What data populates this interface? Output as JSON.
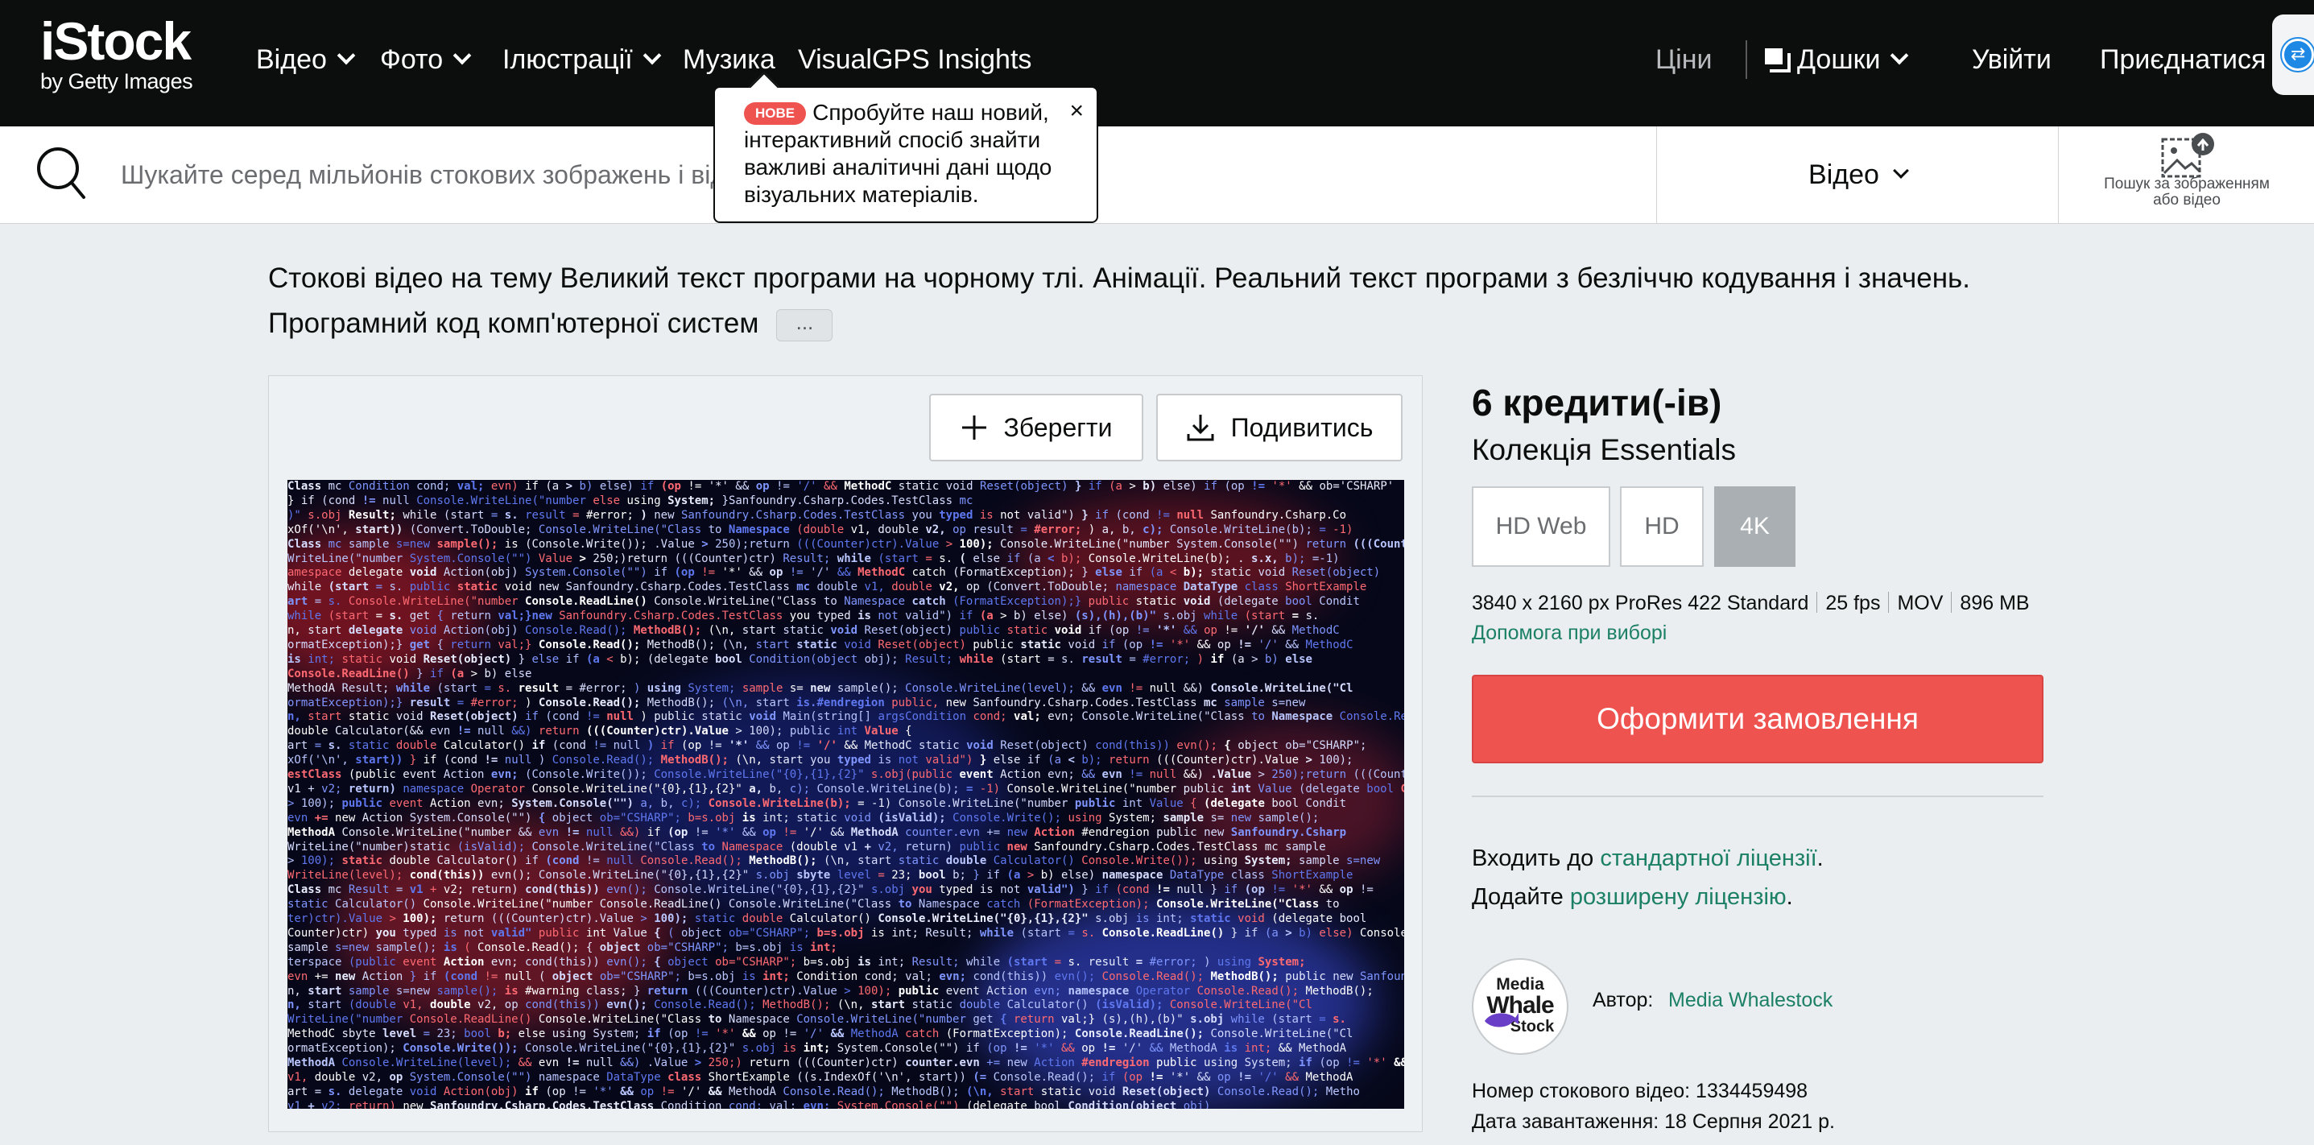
{
  "nav": {
    "logo_main": "iStock",
    "logo_sub": "by Getty Images",
    "video": "Відео",
    "photo": "Фото",
    "illustrations": "Ілюстрації",
    "music": "Музика",
    "visualgps": "VisualGPS Insights",
    "prices": "Ціни",
    "boards": "Дошки",
    "login": "Увійти",
    "join": "Приєднатися"
  },
  "tooltip": {
    "badge": "НОВЕ",
    "text": "Спробуйте наш новий, інтерактивний спосіб знайти важливі аналітичні дані щодо візуальних матеріалів.",
    "close": "×"
  },
  "search": {
    "placeholder": "Шукайте серед мільйонів стокових зображень і відео",
    "type_label": "Відео",
    "image_search_label": "Пошук за зображенням або відео"
  },
  "page": {
    "title": "Стокові відео на тему Великий текст програми на чорному тлі. Анімації. Реальний текст програми з безліччю кодування і значень. Програмний код комп'ютерної систем",
    "more": "..."
  },
  "player": {
    "save_label": "Зберегти",
    "preview_label": "Подивитись"
  },
  "purchase": {
    "price": "6 кредити(-ів)",
    "collection": "Колекція Essentials",
    "resolutions": [
      "HD Web",
      "HD",
      "4K"
    ],
    "selected_resolution": "4K",
    "spec_resolution": "3840 x 2160 px ProRes 422 Standard",
    "spec_fps": "25 fps",
    "spec_format": "MOV",
    "spec_size": "896 MB",
    "help": "Допомога при виборі",
    "order": "Оформити замовлення",
    "license_prefix": "Входить до ",
    "license_link": "стандартної ліцензії",
    "license_suffix": ".",
    "extended_prefix": "Додайте ",
    "extended_link": "розширену ліцензію",
    "extended_suffix": "."
  },
  "author": {
    "logo_line1": "Media",
    "logo_line2": "Whale",
    "logo_line3": "Stock",
    "label": "Автор:",
    "name": "Media Whalestock"
  },
  "meta": {
    "stock_number": "Номер стокового відео: 1334459498",
    "upload_date": "Дата завантаження: 18 Серпня 2021 р."
  },
  "colors": {
    "accent": "#ef5350",
    "link": "#1c8067",
    "nav_bg": "#0c0d0d"
  },
  "code_snippets": [
    "Class mc Condition cond; val; evn) if (a > b) else) if (op != '*' && op != '/' && MethodC static void Reset(object) } if (a > b) else) if (op != '*' && ob='CSHARP'",
    "    } if (cond != null                                    Console.WriteLine(\"number else using System; }Sanfoundry.Csharp.Codes.TestClass mc",
    ")\" s.obj Result; while (start = s. result = #error; ) new Sanfoundry.Csharp.Codes.TestClass you typed is not valid\") } if (cond != null Sanfoundry.Csharp.Co",
    "xOf('\\n', start)) (Convert.ToDouble; Console.WriteLine(\"Class to Namespace (double v1, double v2, op result = #error; ) a, b, c); Console.WriteLine(b); = -1)",
    "Class mc sample s=new sample(); is (Console.Write()); .Value > 250);return (((Counter)ctr).Value > 100); Console.WriteLine(\"number System.Console(\"\") return (((Counter)ct",
    "WriteLine(\"number System.Console(\"\") Value > 250;)return (((Counter)ctr) Result; while (start = s. ( else if (a < b); Console.WriteLine(b); . s.x, b); =-1)",
    "amespace delegate void Action(obj) System.Console(\"\") if (op != '*' && op != '/' && MethodC catch (FormatException); } else if (a < b); static void Reset(object)",
    "while (start = s. public static void new Sanfoundry.Csharp.Codes.TestClass mc double v1, double v2, op (Convert.ToDouble; namespace DataType class ShortExample",
    "art = s. Console.WriteLine(\"number Console.ReadLine() Console.WriteLine(\"Class to Namespace catch (FormatException);} public static void (delegate bool Condit",
    "while (start = s. get { return val;}new Sanfoundry.Csharp.Codes.TestClass you typed is not valid\") if (a > b) else) (s),(h),(b)\" s.obj while (start = s.",
    "n, start delegate void Action(obj) Console.Read(); MethodB(); (\\n, start static void Reset(object) public static void if (op != '*' && op != '/' && MethodC",
    "ormatException);} get { return val;} Console.Read(); MethodB(); (\\n, start static void Reset(object) public static void if (op != '*' && op != '/' && MethodC",
    "is int; static void Reset(object) } else if (a < b); (delegate bool Condition(object obj); Result; while (start = s. result = #error; ) if (a > b) else",
    "       Console.ReadLine()                                                                                  } if (a > b) else",
    "MethodA Result; while (start = s. result = #error; ) using System; sample s= new sample(); Console.WriteLine(level); && evn != null &&) Console.WriteLine(\"Cl",
    "ormatException);} result = #error; ) Console.Read(); MethodB(); (\\n, start is.#endregion public, new Sanfoundry.Csharp.Codes.TestClass mc sample s=new",
    "n, start static void Reset(object) if (cond != null ) public static void Main(string[] argsCondition cond; val; evn; Console.WriteLine(\"Class to Namespace Console.Read(); Metho",
    "double Calculator(&& evn != null &&) return (((Counter)ctr).Value > 100);                public int Value {",
    "art = s. static double Calculator() if (cond != null ) if (op != '*' && op != '/' && MethodC static void Reset(object) cond(this)) evn(); { object ob=\"CSHARP\";",
    "xOf('\\n', start)) } if (cond != null ) Console.Read(); MethodB(); (\\n, start you typed is not valid\") } else if (a < b); return (((Counter)ctr).Value > 100);",
    "estClass (public event Action evn; (Console.Write()); Console.WriteLine(\"{0},{1},{2}\" s.obj(public event Action evn; && evn != null &&) .Value > 250);return (((Counter)ctr",
    "v1 + v2; return) namespace Operator Console.WriteLine(\"{0},{1},{2}\" a, b, c); Console.WriteLine(b); = -1) Console.WriteLine(\"number public int Value (delegate bool Conditi",
    "> 100); public event Action evn; System.Console(\"\") a, b, c); Console.WriteLine(b); = -1) Console.WriteLine(\"number public int Value { (delegate bool Condit",
    "evn += new Action System.Console(\"\") { object ob=\"CSHARP\"; b=s.obj is int; static void (isValid); Console.Write(); using System; sample s= new sample();",
    "MethodA Console.WriteLine(\"number && evn != null &&) if (op != '*' && op != '/' && MethodA counter.evn += new Action #endregion public new Sanfoundry.Csharp",
    "WriteLine(\"number)static (isValid); Console.WriteLine(\"Class to Namespace (double v1 + v2, return) public new Sanfoundry.Csharp.Codes.TestClass mc sample",
    "> 100); static double Calculator() if (cond != null Console.Read(); MethodB(); (\\n, start static double Calculator() Console.Write()); using System; sample s=new",
    "WriteLine(level); cond(this)) evn(); Console.WriteLine(\"{0},{1},{2}\" s.obj sbyte level = 23; bool b; } if (a > b) else) namespace DataType class ShortExample",
    "Class mc Result = v1 + v2; return) cond(this)) evn(); Console.WriteLine(\"{0},{1},{2}\" s.obj you typed is not valid\") } if (cond != null } if (op != '*' && op !=",
    "static Calculator()   Console.WriteLine(\"number Console.ReadLine() Console.WriteLine(\"Class to Namespace catch (FormatException); Console.WriteLine(\"Class to",
    "ter)ctr).Value > 100); return (((Counter)ctr).Value > 100); static double Calculator() Console.WriteLine(\"{0},{1},{2}\" s.obj is int; static void (delegate bool",
    "Counter)ctr) you typed is not valid\" public int Value { ( object ob=\"CSHARP\"; b=s.obj is int; Result; while (start = s. Console.ReadLine() } if (a > b) else) Console",
    "                                                 sample s=new sample(); is ( Console.Read(); { object ob=\"CSHARP\"; b=s.obj is int;",
    "terspace (public event Action evn; cond(this)) evn(); { object ob=\"CSHARP\"; b=s.obj is int; Result; while (start = s. result = #error; ) using System;",
    "evn += new Action } if (cond != null ( object ob=\"CSHARP\"; b=s.obj is int; Condition cond; val; evn; cond(this)) evn(); Console.Read(); MethodB(); public new Sanfoundry.Csharp.Codes.TestClass mc",
    "n, start sample s=new sample(); is #warning class; } return (((Counter)ctr).Value > 100); public event Action evn; namespace Operator Console.Read(); MethodB();",
    "n, start (double v1, double v2, op cond(this)) evn(); Console.Read(); MethodB(); (\\n, start static double Calculator() (isValid); Console.WriteLine(\"Cl",
    "WriteLine(\"number Console.ReadLine() Console.WriteLine(\"Class to Namespace Console.WriteLine(\"number get { return val;} (s),(h),(b)\" s.obj while (start = s.",
    "MethodC sbyte level = 23; bool b; else using System; if (op != '*' && op != '/' && MethodA catch (FormatException); Console.ReadLine(); Console.WriteLine(\"Cl",
    "ormatException); Console.Write()); Console.WriteLine(\"{0},{1},{2}\" s.obj is int; System.Console(\"\") if (op != '*' && op != '/' && MethodA is int; && MethodA",
    "MethodA Console.WriteLine(level); && evn != null &&) .Value > 250;) return (((Counter)ctr) counter.evn += new Action #endregion public using System; if (op != '*' && op",
    "v1, double v2, op System.Console(\"\") namespace DataType class ShortExample ((s.IndexOf('\\n', start)) (= Console.Read(); if (op != '*' && op != '/' && MethodA",
    "art = s. delegate void Action(obj) if (op != '*' && op != '/' && MethodA Console.Read(); MethodB(); (\\n, start static void Reset(object) Console.Read(); Metho",
    "v1 + v2; return) new Sanfoundry.Csharp.Codes.TestClass Condition cond; val; evn; System.Console(\"\") (delegate bool Condition(object obj)"
  ]
}
